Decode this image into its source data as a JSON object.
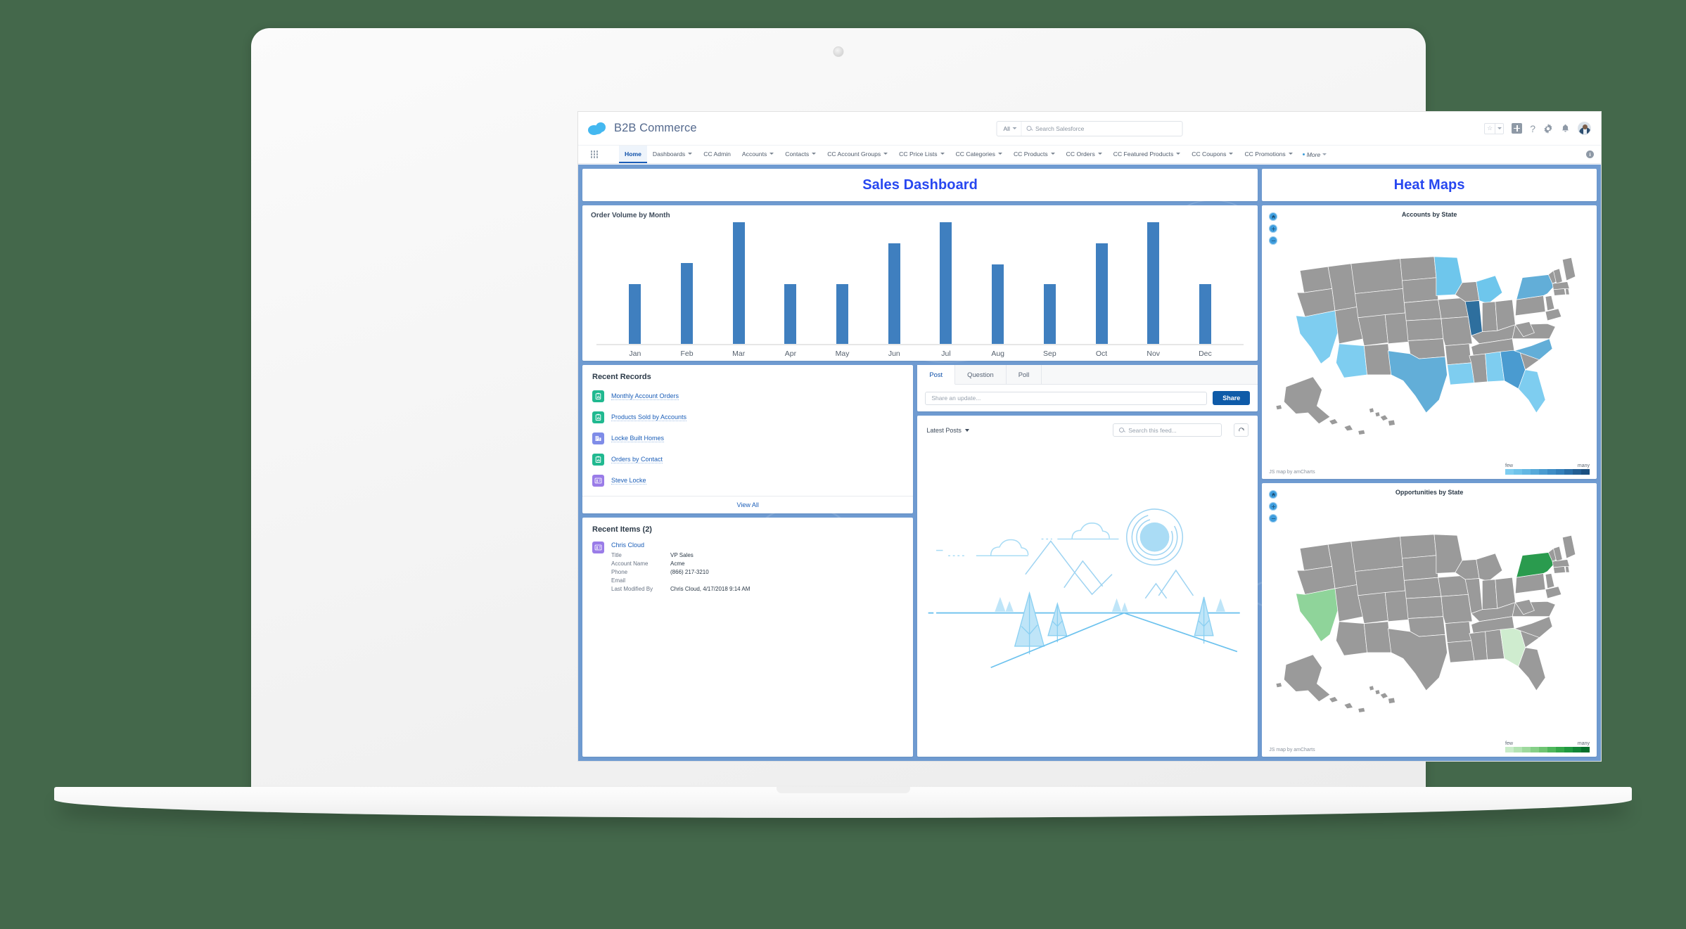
{
  "header": {
    "app_name": "B2B Commerce",
    "logo_icon": "salesforce-cloud-icon",
    "search": {
      "scope_label": "All",
      "placeholder": "Search Salesforce",
      "icon": "search-icon"
    },
    "actions": [
      {
        "name": "favorites-star-icon",
        "label": "☆"
      },
      {
        "name": "favorites-dropdown-icon",
        "label": "▾"
      },
      {
        "name": "global-create-icon",
        "label": "+"
      },
      {
        "name": "help-icon",
        "label": "?"
      },
      {
        "name": "setup-gear-icon",
        "label": "gear"
      },
      {
        "name": "notifications-bell-icon",
        "label": "bell"
      },
      {
        "name": "user-avatar",
        "label": "avatar"
      }
    ]
  },
  "nav": {
    "app_launcher_icon": "app-launcher-grid-icon",
    "items": [
      {
        "label": "Home",
        "has_menu": false,
        "active": true
      },
      {
        "label": "Dashboards",
        "has_menu": true,
        "active": false
      },
      {
        "label": "CC Admin",
        "has_menu": false,
        "active": false
      },
      {
        "label": "Accounts",
        "has_menu": true,
        "active": false
      },
      {
        "label": "Contacts",
        "has_menu": true,
        "active": false
      },
      {
        "label": "CC Account Groups",
        "has_menu": true,
        "active": false
      },
      {
        "label": "CC Price Lists",
        "has_menu": true,
        "active": false
      },
      {
        "label": "CC Categories",
        "has_menu": true,
        "active": false
      },
      {
        "label": "CC Products",
        "has_menu": true,
        "active": false
      },
      {
        "label": "CC Orders",
        "has_menu": true,
        "active": false
      },
      {
        "label": "CC Featured Products",
        "has_menu": true,
        "active": false
      },
      {
        "label": "CC Coupons",
        "has_menu": true,
        "active": false
      },
      {
        "label": "CC Promotions",
        "has_menu": true,
        "active": false
      }
    ],
    "more_label": "More",
    "info_icon": "info-icon"
  },
  "dashboards": {
    "sales_title": "Sales Dashboard",
    "heat_title": "Heat Maps"
  },
  "chart_data": {
    "type": "bar",
    "title": "Order Volume by Month",
    "xlabel": "",
    "ylabel": "",
    "categories": [
      "Jan",
      "Feb",
      "Mar",
      "Apr",
      "May",
      "Jun",
      "Jul",
      "Aug",
      "Sep",
      "Oct",
      "Nov",
      "Dec"
    ],
    "values": [
      50,
      67,
      100,
      50,
      50,
      83,
      100,
      66,
      50,
      83,
      100,
      50
    ],
    "ylim": [
      0,
      100
    ],
    "grid": false,
    "legend": "none",
    "series_color": "#3f7fbf"
  },
  "recent_records": {
    "title": "Recent Records",
    "items": [
      {
        "label": "Monthly Account Orders",
        "icon": "report-icon",
        "icon_type": "report"
      },
      {
        "label": "Products Sold by Accounts",
        "icon": "report-icon",
        "icon_type": "report"
      },
      {
        "label": "Locke Built Homes",
        "icon": "account-icon",
        "icon_type": "account"
      },
      {
        "label": "Orders by Contact",
        "icon": "report-icon",
        "icon_type": "report"
      },
      {
        "label": "Steve Locke",
        "icon": "contact-icon",
        "icon_type": "contact"
      }
    ],
    "view_all_label": "View All"
  },
  "recent_items": {
    "title": "Recent Items (2)",
    "record": {
      "name": "Chris Cloud",
      "icon": "contact-icon",
      "fields": [
        {
          "key": "Title",
          "value": "VP Sales"
        },
        {
          "key": "Account Name",
          "value": "Acme"
        },
        {
          "key": "Phone",
          "value": "(866) 217-3210"
        },
        {
          "key": "Email",
          "value": ""
        },
        {
          "key": "Last Modified By",
          "value": "Chris Cloud, 4/17/2018 9:14 AM"
        }
      ]
    }
  },
  "publisher": {
    "tabs": [
      {
        "label": "Post",
        "active": true
      },
      {
        "label": "Question",
        "active": false
      },
      {
        "label": "Poll",
        "active": false
      }
    ],
    "input_placeholder": "Share an update...",
    "share_label": "Share"
  },
  "feed": {
    "sort_label": "Latest Posts",
    "search_placeholder": "Search this feed...",
    "search_icon": "search-icon",
    "refresh_icon": "refresh-icon",
    "illustration": "empty-feed-landscape-illustration"
  },
  "maps": [
    {
      "title": "Accounts by State",
      "credit": "JS map by amCharts",
      "legend": {
        "low_label": "few",
        "high_label": "many",
        "colors": [
          "#7ecdf0",
          "#6fc3ea",
          "#62b7e3",
          "#56a9d9",
          "#4a9bd0",
          "#3e8dc6",
          "#3480bb",
          "#2a6fa8",
          "#225e93",
          "#1a4f80"
        ]
      },
      "base_color": "#9a9a9a",
      "highlights": [
        {
          "state": "CA",
          "color": "#7ecdf0"
        },
        {
          "state": "AZ",
          "color": "#7ecdf0"
        },
        {
          "state": "TX",
          "color": "#62aed8"
        },
        {
          "state": "MN",
          "color": "#6ec6ec"
        },
        {
          "state": "MI",
          "color": "#6ec6ec"
        },
        {
          "state": "IL",
          "color": "#2e6f9e"
        },
        {
          "state": "NY",
          "color": "#62aed8"
        },
        {
          "state": "AL",
          "color": "#7ecdf0"
        },
        {
          "state": "GA",
          "color": "#4a9bd0"
        },
        {
          "state": "FL",
          "color": "#7ecdf0"
        },
        {
          "state": "NC",
          "color": "#62aed8"
        },
        {
          "state": "LA",
          "color": "#7ecdf0"
        }
      ],
      "controls": [
        "home-icon",
        "zoom-in-icon",
        "zoom-out-icon"
      ]
    },
    {
      "title": "Opportunities by State",
      "credit": "JS map by amCharts",
      "legend": {
        "low_label": "few",
        "high_label": "many",
        "colors": [
          "#c9ecc9",
          "#b3e3b3",
          "#9dd99d",
          "#85cf87",
          "#6ec472",
          "#4fb75c",
          "#34a84a",
          "#1f9940",
          "#118537",
          "#06702c"
        ]
      },
      "base_color": "#9a9a9a",
      "highlights": [
        {
          "state": "CA",
          "color": "#8fd49a"
        },
        {
          "state": "GA",
          "color": "#cfeccf"
        },
        {
          "state": "NY",
          "color": "#2a9b4e"
        }
      ],
      "controls": [
        "home-icon",
        "zoom-in-icon",
        "zoom-out-icon"
      ]
    }
  ]
}
